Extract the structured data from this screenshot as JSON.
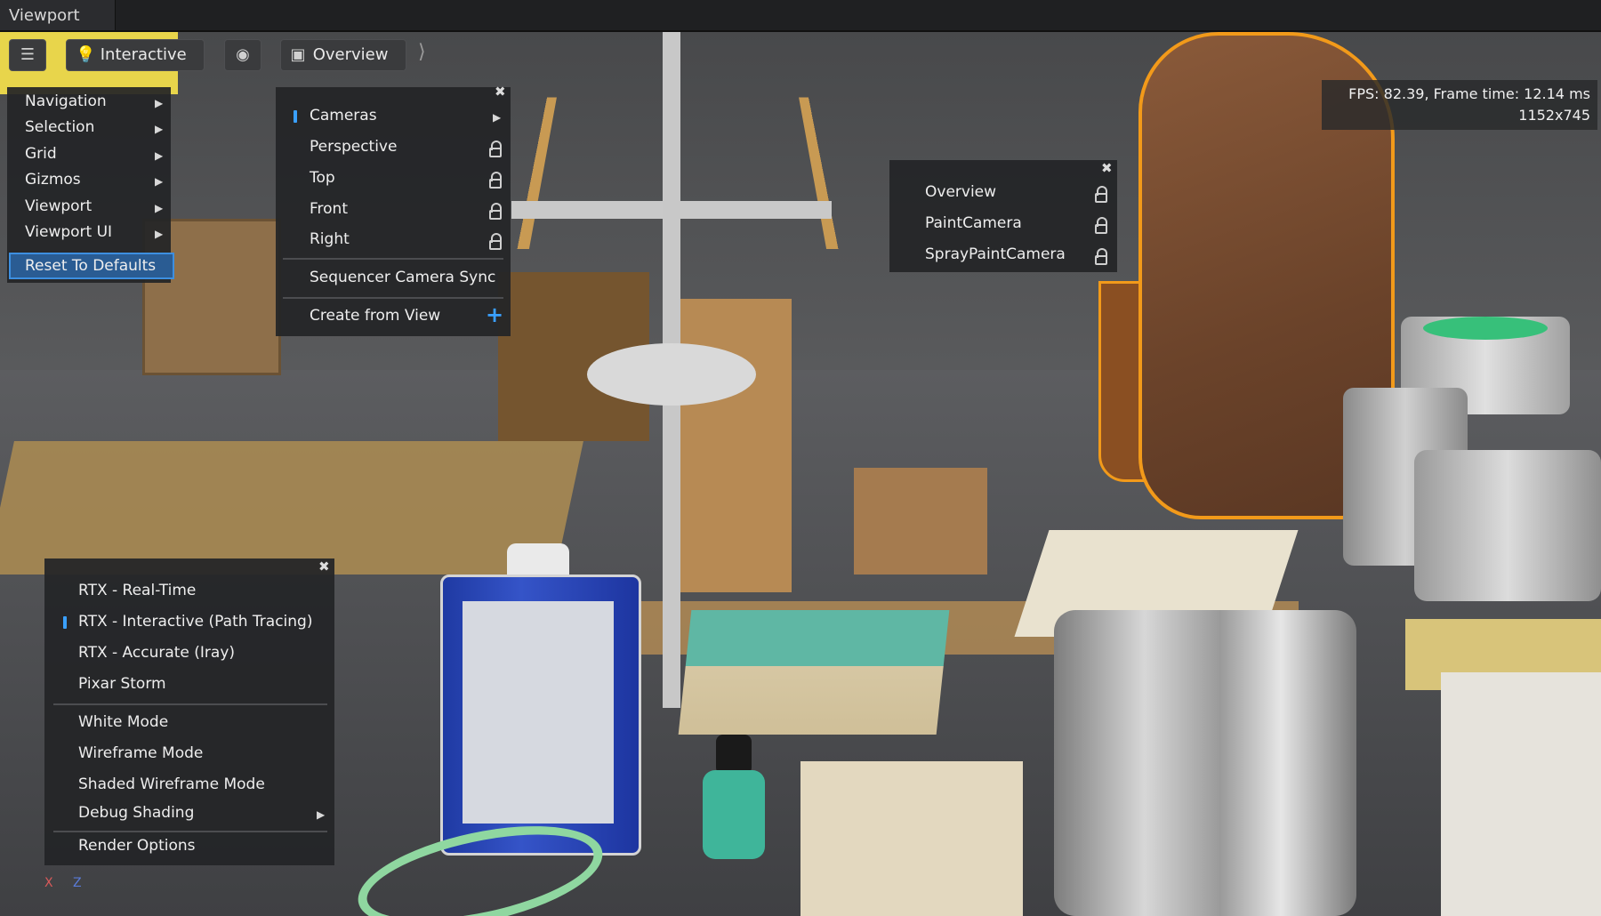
{
  "window": {
    "tab_title": "Viewport"
  },
  "toolbar": {
    "render_mode_label": "Interactive",
    "camera_label": "Overview"
  },
  "stats": {
    "fps_line": "FPS: 82.39, Frame time: 12.14 ms",
    "resolution": "1152x745"
  },
  "settings_menu": {
    "items": [
      {
        "label": "Navigation",
        "has_submenu": true
      },
      {
        "label": "Selection",
        "has_submenu": true
      },
      {
        "label": "Grid",
        "has_submenu": true
      },
      {
        "label": "Gizmos",
        "has_submenu": true
      },
      {
        "label": "Viewport",
        "has_submenu": true
      },
      {
        "label": "Viewport UI",
        "has_submenu": true
      }
    ],
    "reset_label": "Reset To Defaults"
  },
  "camera_menu": {
    "cameras_label": "Cameras",
    "items": [
      {
        "label": "Perspective"
      },
      {
        "label": "Top"
      },
      {
        "label": "Front"
      },
      {
        "label": "Right"
      }
    ],
    "sequencer_label": "Sequencer Camera Sync",
    "create_label": "Create from View"
  },
  "cameras_submenu": {
    "items": [
      {
        "label": "Overview"
      },
      {
        "label": "PaintCamera"
      },
      {
        "label": "SprayPaintCamera"
      }
    ]
  },
  "render_menu": {
    "items": [
      {
        "label": "RTX - Real-Time",
        "selected": false
      },
      {
        "label": "RTX - Interactive (Path Tracing)",
        "selected": true
      },
      {
        "label": "RTX - Accurate (Iray)",
        "selected": false
      },
      {
        "label": "Pixar Storm",
        "selected": false
      }
    ],
    "modes": [
      {
        "label": "White Mode"
      },
      {
        "label": "Wireframe Mode"
      },
      {
        "label": "Shaded Wireframe Mode"
      },
      {
        "label": "Debug Shading"
      }
    ],
    "options_label": "Render Options"
  },
  "colors": {
    "accent": "#3aa0ff",
    "selection_outline": "#f29a1a",
    "menu_bg": "#242527"
  },
  "axis_labels": {
    "x": "X",
    "z": "Z"
  }
}
